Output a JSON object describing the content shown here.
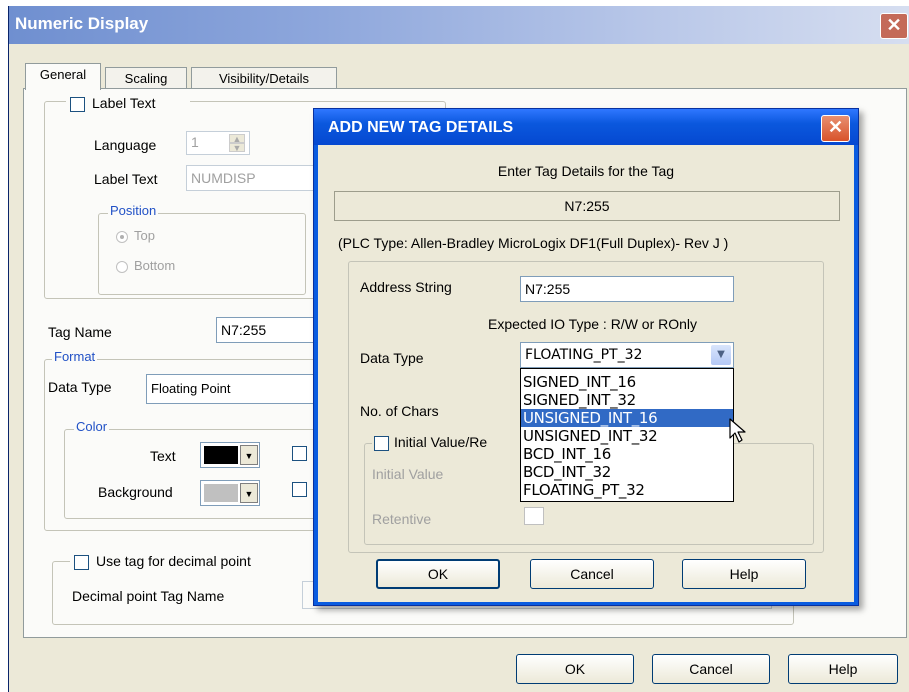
{
  "window": {
    "title": "Numeric Display",
    "close_glyph": "✕",
    "tabs": [
      {
        "label": "General"
      },
      {
        "label": "Scaling"
      },
      {
        "label": "Visibility/Details"
      }
    ],
    "label_text_group": {
      "checkbox_label": "Label Text",
      "language_label": "Language",
      "language_value": "1",
      "label_text_label": "Label Text",
      "label_text_value": "NUMDISP",
      "position": {
        "legend": "Position",
        "options": [
          "Top",
          "Bottom"
        ],
        "selected": "Top"
      }
    },
    "tag_name_label": "Tag Name",
    "tag_name_value": "N7:255",
    "format": {
      "legend": "Format",
      "data_type_label": "Data Type",
      "data_type_value": "Floating Point",
      "color": {
        "legend": "Color",
        "text_label": "Text",
        "background_label": "Background",
        "text_color": "#000000",
        "background_color": "#c0c0c0"
      }
    },
    "decimal": {
      "checkbox_label": "Use tag for decimal point",
      "tag_label": "Decimal point Tag Name"
    },
    "buttons": {
      "ok": "OK",
      "cancel": "Cancel",
      "help": "Help"
    }
  },
  "dialog": {
    "title": "ADD NEW TAG DETAILS",
    "close_glyph": "✕",
    "heading": "Enter Tag Details for the Tag",
    "tag": "N7:255",
    "plc_type": "(PLC Type:  Allen-Bradley MicroLogix DF1(Full Duplex)- Rev J )",
    "address_label": "Address String",
    "address_value": "N7:255",
    "expected_io": "Expected IO Type : R/W or ROnly",
    "data_type_label": "Data Type",
    "data_type_value": "FLOATING_PT_32",
    "no_chars_label": "No. of Chars",
    "initial_group_label": "Initial Value/Re",
    "initial_value_label": "Initial Value",
    "retentive_label": "Retentive",
    "dropdown_options": [
      "SIGNED_INT_16",
      "SIGNED_INT_32",
      "UNSIGNED_INT_16",
      "UNSIGNED_INT_32",
      "BCD_INT_16",
      "BCD_INT_32",
      "FLOATING_PT_32"
    ],
    "highlighted_option": "UNSIGNED_INT_16",
    "buttons": {
      "ok": "OK",
      "cancel": "Cancel",
      "help": "Help"
    }
  },
  "colors": {
    "dialog_title": "#0b58de",
    "highlight": "#316ac5",
    "legend_text": "#2151c6"
  }
}
